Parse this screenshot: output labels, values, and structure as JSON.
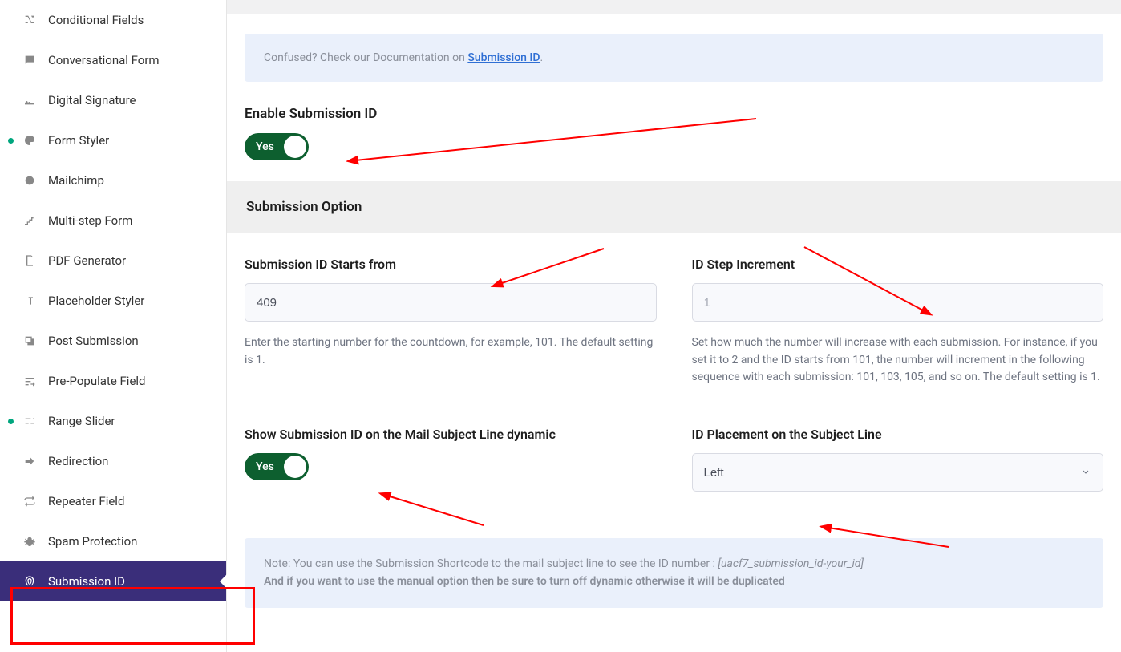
{
  "sidebar": {
    "items": [
      {
        "label": "Conditional Fields",
        "icon": "shuffle-icon"
      },
      {
        "label": "Conversational Form",
        "icon": "chat-icon"
      },
      {
        "label": "Digital Signature",
        "icon": "signature-icon"
      },
      {
        "label": "Form Styler",
        "icon": "paint-icon",
        "dot": true
      },
      {
        "label": "Mailchimp",
        "icon": "mailchimp-icon"
      },
      {
        "label": "Multi-step Form",
        "icon": "steps-icon"
      },
      {
        "label": "PDF Generator",
        "icon": "pdf-icon"
      },
      {
        "label": "Placeholder Styler",
        "icon": "text-icon"
      },
      {
        "label": "Post Submission",
        "icon": "post-icon"
      },
      {
        "label": "Pre-Populate Field",
        "icon": "prepopulate-icon"
      },
      {
        "label": "Range Slider",
        "icon": "slider-icon",
        "dot": true
      },
      {
        "label": "Redirection",
        "icon": "redirect-icon"
      },
      {
        "label": "Repeater Field",
        "icon": "repeat-icon"
      },
      {
        "label": "Spam Protection",
        "icon": "bug-icon"
      },
      {
        "label": "Submission ID",
        "icon": "fingerprint-icon",
        "active": true
      }
    ]
  },
  "info": {
    "prefix": "Confused? Check our Documentation on ",
    "link_text": "Submission ID",
    "suffix": "."
  },
  "enable": {
    "label": "Enable Submission ID",
    "toggle_text": "Yes"
  },
  "sub_header": "Submission Option",
  "starts_from": {
    "label": "Submission ID Starts from",
    "value": "409",
    "helper": "Enter the starting number for the countdown, for example, 101. The default setting is 1."
  },
  "increment": {
    "label": "ID Step Increment",
    "placeholder": "1",
    "helper": "Set how much the number will increase with each submission. For instance, if you set it to 2 and the ID starts from 101, the number will increment in the following sequence with each submission: 101, 103, 105, and so on. The default setting is 1."
  },
  "show_mail": {
    "label": "Show Submission ID on the Mail Subject Line dynamic",
    "toggle_text": "Yes"
  },
  "placement": {
    "label": "ID Placement on the Subject Line",
    "value": "Left"
  },
  "note": {
    "line1_prefix": "Note: You can use the Submission Shortcode to the mail subject line to see the ID number : ",
    "line1_em": "[uacf7_submission_id-your_id]",
    "line2": "And if you want to use the manual option then be sure to turn off dynamic otherwise it will be duplicated"
  }
}
